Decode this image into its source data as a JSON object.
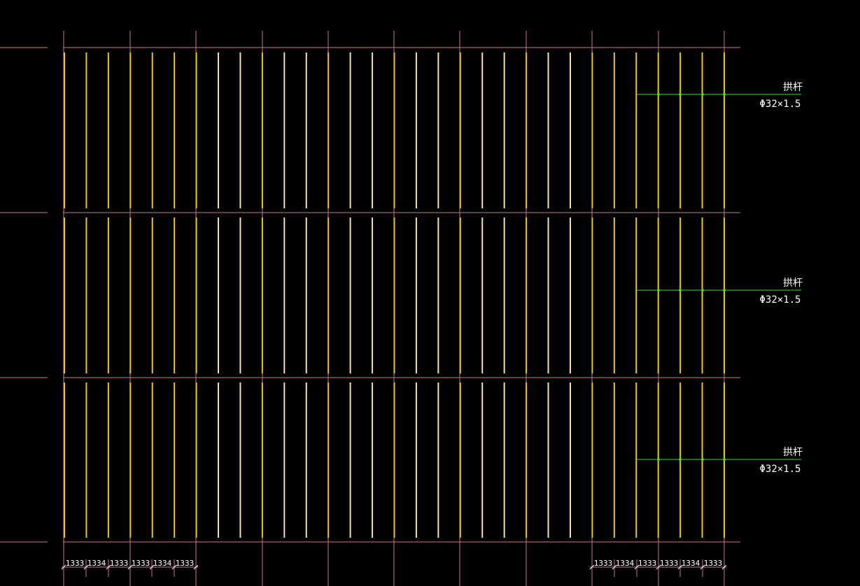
{
  "drawing": {
    "background": "#000000",
    "colors": {
      "grid_line": "#c87c86",
      "batten": "#f2c12e",
      "batten_alt": "#f7e2a2",
      "brace": "#3ddc3d",
      "text": "#ffffff"
    },
    "panels": 3,
    "battens_per_panel": 31,
    "annotations": [
      {
        "name": "拱杆",
        "spec": "Φ32×1.5"
      },
      {
        "name": "拱杆",
        "spec": "Φ32×1.5"
      },
      {
        "name": "拱杆",
        "spec": "Φ32×1.5"
      }
    ],
    "dimensions_left": [
      "1333",
      "1334",
      "1333",
      "1333",
      "1334",
      "1333"
    ],
    "dimensions_right": [
      "1333",
      "1334",
      "1333",
      "1333",
      "1334",
      "1333"
    ]
  }
}
